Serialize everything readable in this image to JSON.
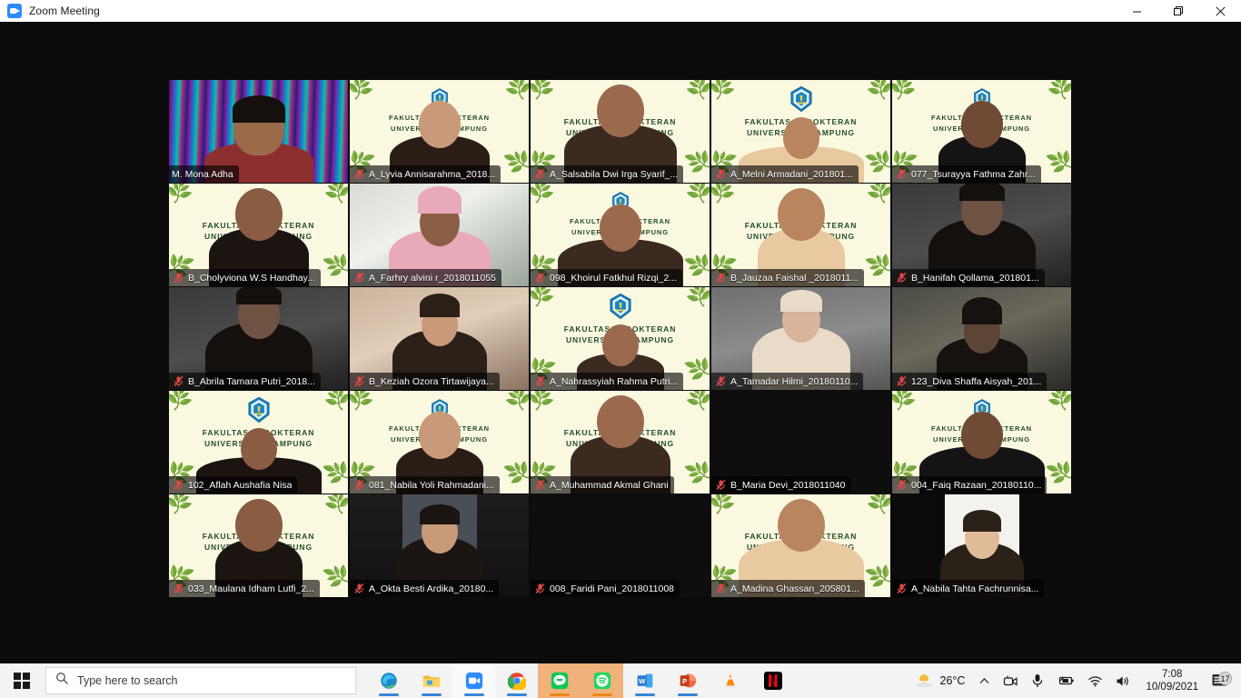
{
  "window": {
    "title": "Zoom Meeting",
    "app_icon": "zoom-camera-icon",
    "minimize_label": "Minimize",
    "maximize_label": "Restore",
    "close_label": "Close"
  },
  "meeting": {
    "virtual_background_text_line1": "FAKULTAS KEDOKTERAN",
    "virtual_background_text_line2": "UNIVERSITAS LAMPUNG",
    "grid_columns": 5,
    "grid_rows": 5,
    "active_speaker_border_color": "#f2ef7a",
    "participants": [
      {
        "name": "M. Mona Adha",
        "muted": false,
        "active": true,
        "bg": "glitter"
      },
      {
        "name": "A_Lyvia Annisarahma_2018...",
        "muted": true,
        "active": false,
        "bg": "unila"
      },
      {
        "name": "A_Salsabila Dwi Irga Syarif_...",
        "muted": true,
        "active": false,
        "bg": "unila"
      },
      {
        "name": "A_Melni Armadani_201801...",
        "muted": true,
        "active": false,
        "bg": "unila"
      },
      {
        "name": "077_Tsurayya Fathma Zahr...",
        "muted": true,
        "active": false,
        "bg": "unila"
      },
      {
        "name": "B_Cholyviona W.S Handhay...",
        "muted": true,
        "active": false,
        "bg": "unila"
      },
      {
        "name": "A_Farhry alvini r_2018011055",
        "muted": true,
        "active": false,
        "bg": "room-light"
      },
      {
        "name": "098_Khoirul Fatkhul Rizqi_2...",
        "muted": true,
        "active": false,
        "bg": "unila"
      },
      {
        "name": "B_Jauzaa Faishal _2018011...",
        "muted": true,
        "active": false,
        "bg": "unila"
      },
      {
        "name": "B_Hanifah Qollama_201801...",
        "muted": true,
        "active": false,
        "bg": "dark-room"
      },
      {
        "name": "B_Abrila Tamara Putri_2018...",
        "muted": true,
        "active": false,
        "bg": "dark-room"
      },
      {
        "name": "B_Keziah Ozora Tirtawijaya...",
        "muted": true,
        "active": false,
        "bg": "room-warm"
      },
      {
        "name": "A_Nahrassyiah Rahma Putri...",
        "muted": true,
        "active": false,
        "bg": "unila"
      },
      {
        "name": "A_Tamadar Hilmi_20180110...",
        "muted": true,
        "active": false,
        "bg": "room-grey"
      },
      {
        "name": "123_Diva Shaffa Aisyah_201...",
        "muted": true,
        "active": false,
        "bg": "window-dark"
      },
      {
        "name": "102_Aflah Aushafia Nisa",
        "muted": true,
        "active": false,
        "bg": "unila"
      },
      {
        "name": "081_Nabila Yoli Rahmadani...",
        "muted": true,
        "active": false,
        "bg": "unila"
      },
      {
        "name": "A_Muhammad Akmal Ghani",
        "muted": true,
        "active": false,
        "bg": "unila"
      },
      {
        "name": "B_Maria Devi_2018011040",
        "muted": true,
        "active": false,
        "bg": "black"
      },
      {
        "name": "004_Faiq Razaan_20180110...",
        "muted": true,
        "active": false,
        "bg": "unila"
      },
      {
        "name": "033_Maulana Idham Lutfi_2...",
        "muted": true,
        "active": false,
        "bg": "unila"
      },
      {
        "name": "A_Okta Besti Ardika_20180...",
        "muted": true,
        "active": false,
        "bg": "portrait-dark"
      },
      {
        "name": "008_Faridi Pani_2018011008",
        "muted": true,
        "active": false,
        "bg": "black"
      },
      {
        "name": "A_Madina Ghassan_205801...",
        "muted": true,
        "active": false,
        "bg": "unila"
      },
      {
        "name": "A_Nabila Tahta Fachrunnisa...",
        "muted": true,
        "active": false,
        "bg": "portrait-white"
      }
    ]
  },
  "taskbar": {
    "start_label": "Start",
    "search_placeholder": "Type here to search",
    "search_icon": "search-icon",
    "apps": [
      {
        "name": "Microsoft Edge",
        "icon": "edge-icon",
        "running": true,
        "highlight": "none"
      },
      {
        "name": "File Explorer",
        "icon": "folder-icon",
        "running": true,
        "highlight": "none"
      },
      {
        "name": "Zoom",
        "icon": "zoom-icon",
        "running": true,
        "highlight": "active"
      },
      {
        "name": "Google Chrome",
        "icon": "chrome-icon",
        "running": true,
        "highlight": "none"
      },
      {
        "name": "LINE",
        "icon": "line-icon",
        "running": true,
        "highlight": "tinted"
      },
      {
        "name": "Spotify",
        "icon": "spotify-icon",
        "running": true,
        "highlight": "tinted"
      },
      {
        "name": "Microsoft Word",
        "icon": "word-icon",
        "running": true,
        "highlight": "none"
      },
      {
        "name": "Microsoft PowerPoint",
        "icon": "powerpoint-icon",
        "running": true,
        "highlight": "none"
      },
      {
        "name": "VLC media player",
        "icon": "vlc-cone-icon",
        "running": false,
        "highlight": "none"
      },
      {
        "name": "Netflix",
        "icon": "netflix-icon",
        "running": false,
        "highlight": "none"
      }
    ],
    "tray": {
      "weather_temp": "26°C",
      "weather_icon": "sun-cloud-icon",
      "overflow_icon": "chevron-up-icon",
      "camera_icon": "camera-icon",
      "mic_icon": "microphone-icon",
      "battery_icon": "battery-charging-icon",
      "wifi_icon": "wifi-icon",
      "volume_icon": "speaker-icon",
      "time": "7:08",
      "date": "10/09/2021",
      "notifications_icon": "action-center-icon",
      "notifications_count": "17"
    }
  }
}
